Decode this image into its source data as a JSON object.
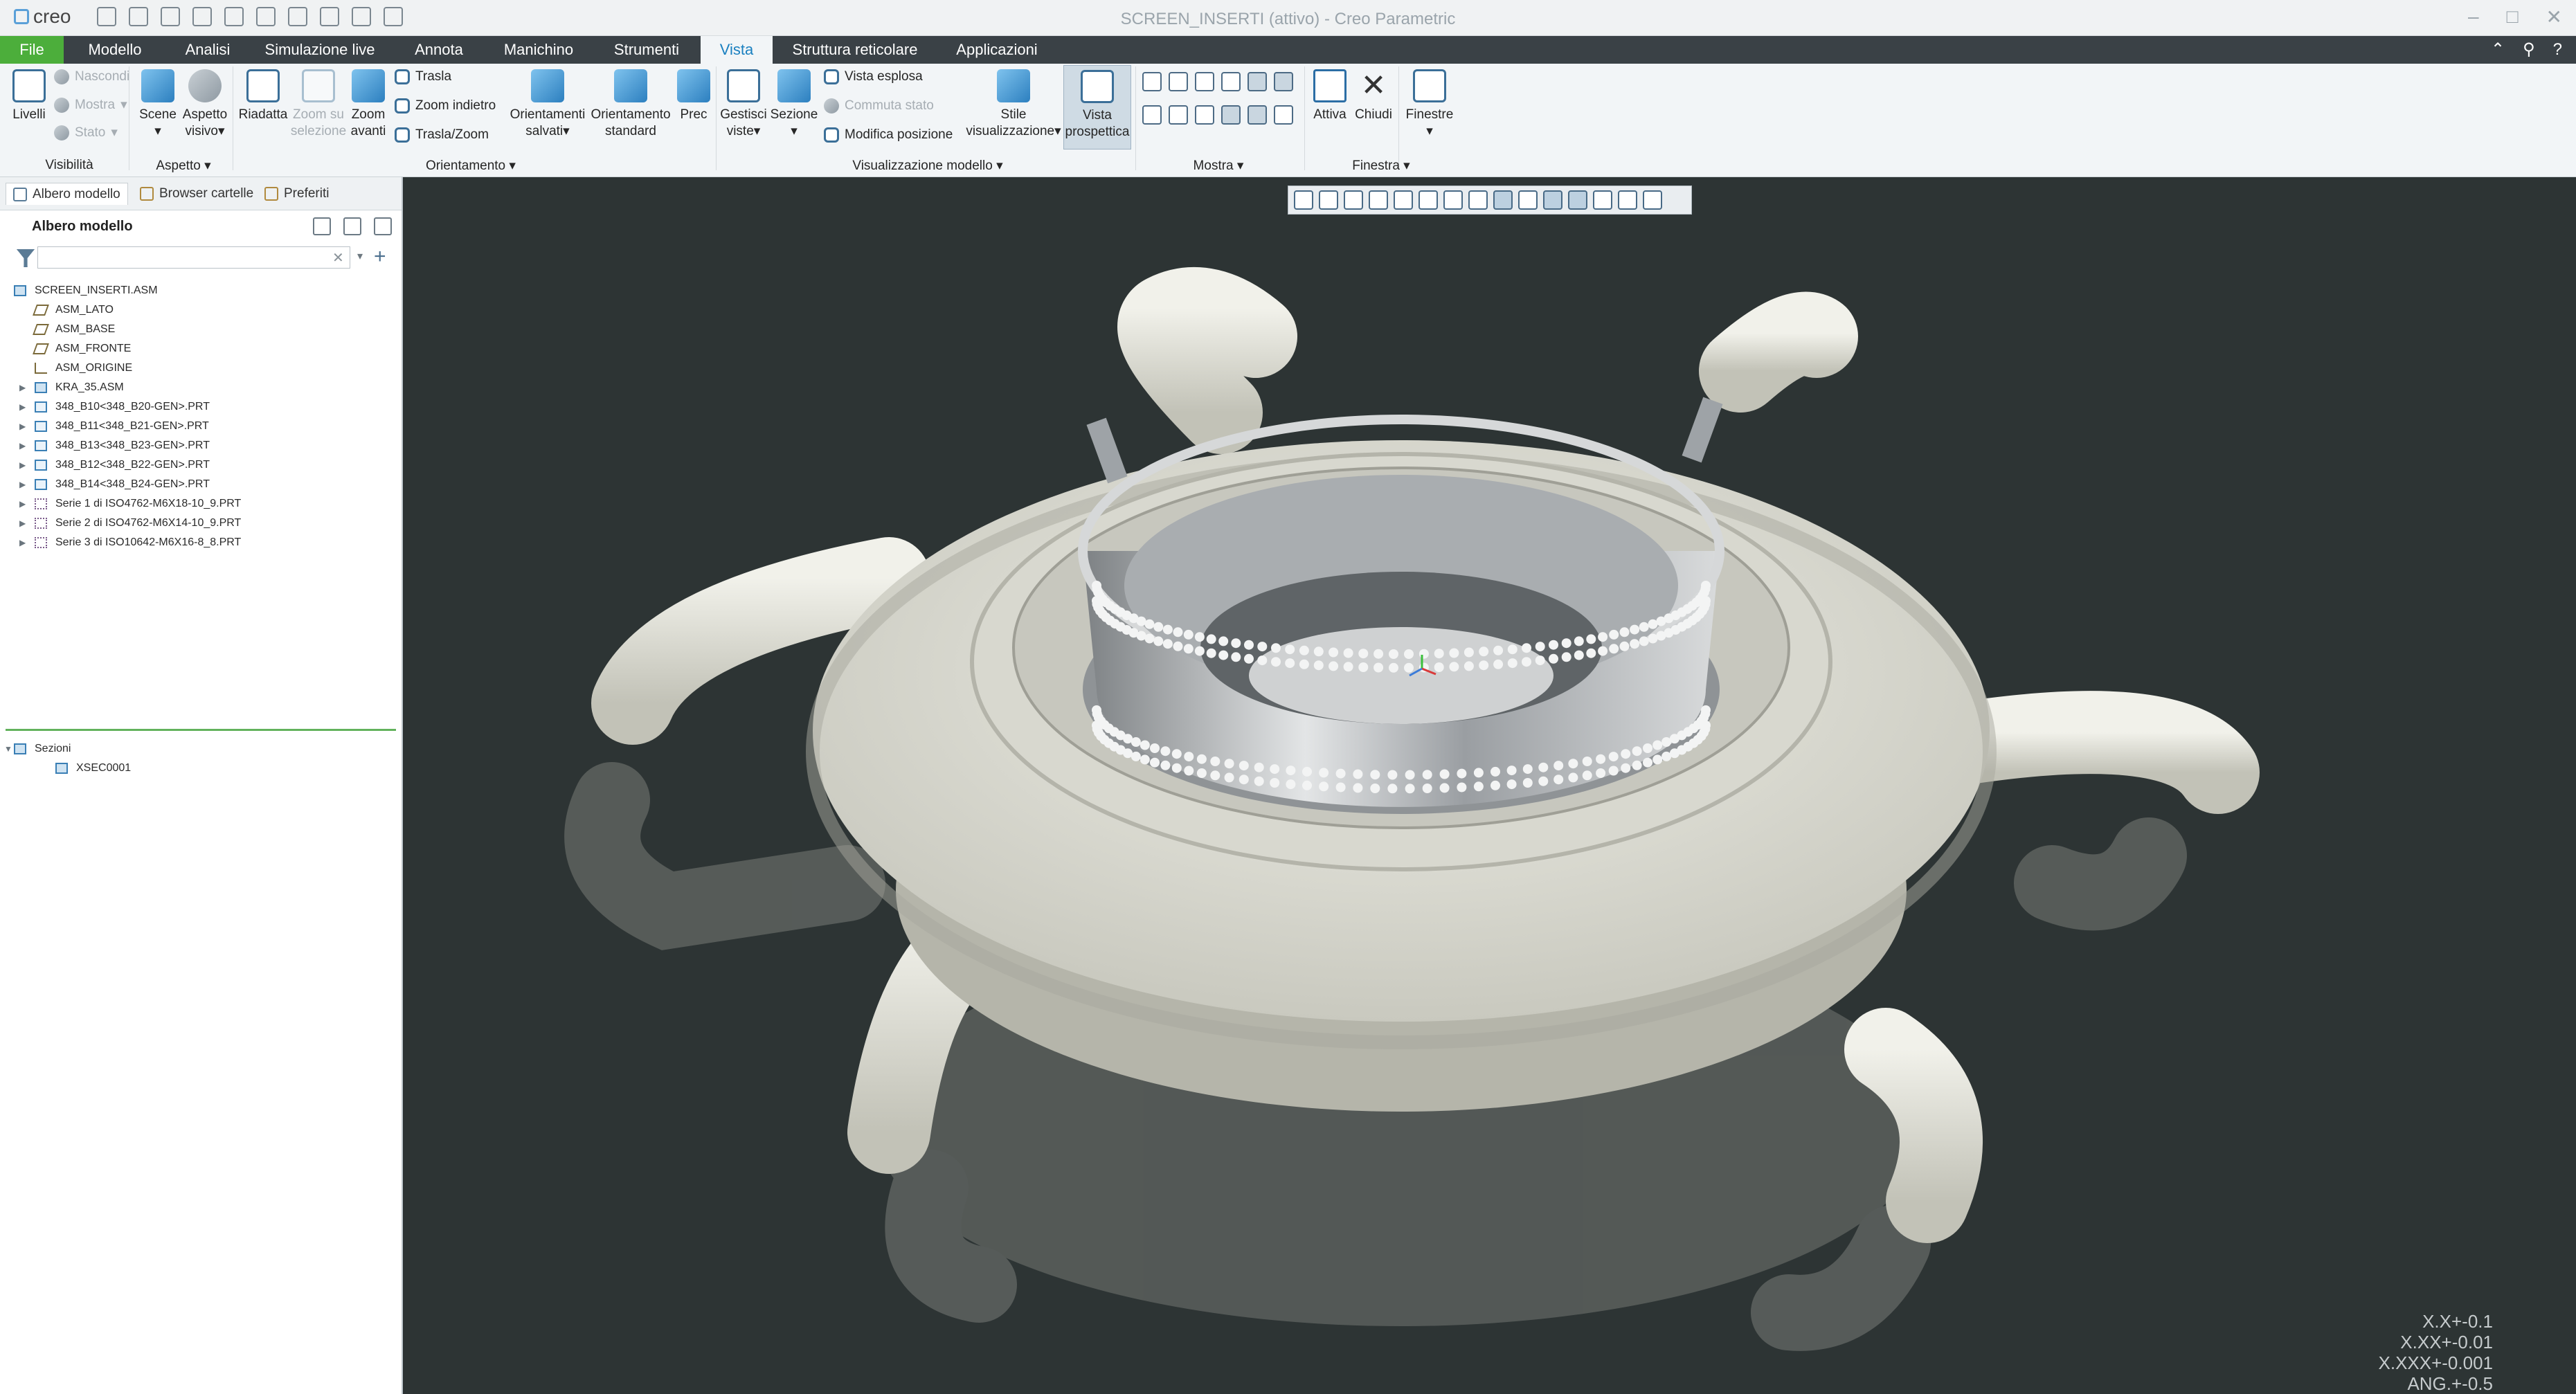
{
  "app": {
    "brand": "creo",
    "window_title": "SCREEN_INSERTI (attivo) - Creo Parametric"
  },
  "tabs": [
    "File",
    "Modello",
    "Analisi",
    "Simulazione live",
    "Annota",
    "Manichino",
    "Strumenti",
    "Vista",
    "Struttura reticolare",
    "Applicazioni"
  ],
  "active_tab": "Vista",
  "ribbon": {
    "visibilita": {
      "livelli": "Livelli",
      "nascondi": "Nascondi",
      "mostra": "Mostra",
      "stato": "Stato",
      "group": "Visibilità"
    },
    "aspetto": {
      "scene": "Scene",
      "aspetto_visivo_1": "Aspetto",
      "aspetto_visivo_2": "visivo",
      "group": "Aspetto"
    },
    "orientamento": {
      "riadatta": "Riadatta",
      "zoom_sel_1": "Zoom su",
      "zoom_sel_2": "selezione",
      "zoom_avanti_1": "Zoom",
      "zoom_avanti_2": "avanti",
      "trasla": "Trasla",
      "zoom_indietro": "Zoom indietro",
      "trasla_zoom": "Trasla/Zoom",
      "orient_salvati_1": "Orientamenti",
      "orient_salvati_2": "salvati",
      "orient_std_1": "Orientamento",
      "orient_std_2": "standard",
      "prec": "Prec",
      "group": "Orientamento"
    },
    "visualizzazione": {
      "gestisci_1": "Gestisci",
      "gestisci_2": "viste",
      "sezione": "Sezione",
      "vista_esplosa": "Vista esplosa",
      "commuta_stato": "Commuta stato",
      "modifica_posizione": "Modifica posizione",
      "stile_1": "Stile",
      "stile_2": "visualizzazione",
      "prospettica_1": "Vista",
      "prospettica_2": "prospettica",
      "group": "Visualizzazione modello"
    },
    "mostra_group": "Mostra",
    "finestra": {
      "attiva": "Attiva",
      "chiudi": "Chiudi",
      "finestre": "Finestre",
      "group": "Finestra"
    }
  },
  "panel": {
    "tabs": [
      "Albero modello",
      "Browser cartelle",
      "Preferiti"
    ],
    "header": "Albero modello",
    "filter_placeholder": "",
    "tree": [
      {
        "label": "SCREEN_INSERTI.ASM",
        "type": "asm",
        "level": 0,
        "expand": ""
      },
      {
        "label": "ASM_LATO",
        "type": "plane",
        "level": 1,
        "expand": ""
      },
      {
        "label": "ASM_BASE",
        "type": "plane",
        "level": 1,
        "expand": ""
      },
      {
        "label": "ASM_FRONTE",
        "type": "plane",
        "level": 1,
        "expand": ""
      },
      {
        "label": "ASM_ORIGINE",
        "type": "csys",
        "level": 1,
        "expand": ""
      },
      {
        "label": "KRA_35.ASM",
        "type": "asm",
        "level": 1,
        "expand": "▶"
      },
      {
        "label": "348_B10<348_B20-GEN>.PRT",
        "type": "part",
        "level": 1,
        "expand": "▶"
      },
      {
        "label": "348_B11<348_B21-GEN>.PRT",
        "type": "part",
        "level": 1,
        "expand": "▶"
      },
      {
        "label": "348_B13<348_B23-GEN>.PRT",
        "type": "part",
        "level": 1,
        "expand": "▶"
      },
      {
        "label": "348_B12<348_B22-GEN>.PRT",
        "type": "part",
        "level": 1,
        "expand": "▶"
      },
      {
        "label": "348_B14<348_B24-GEN>.PRT",
        "type": "part",
        "level": 1,
        "expand": "▶"
      },
      {
        "label": "Serie 1 di ISO4762-M6X18-10_9.PRT",
        "type": "pat",
        "level": 1,
        "expand": "▶"
      },
      {
        "label": "Serie 2 di ISO4762-M6X14-10_9.PRT",
        "type": "pat",
        "level": 1,
        "expand": "▶"
      },
      {
        "label": "Serie 3 di ISO10642-M6X16-8_8.PRT",
        "type": "pat",
        "level": 1,
        "expand": "▶"
      }
    ],
    "sections": [
      {
        "label": "Sezioni",
        "type": "asm",
        "level": 0,
        "expand": "▼"
      },
      {
        "label": "XSEC0001",
        "type": "asm",
        "level": 2,
        "expand": ""
      }
    ]
  },
  "viewport": {
    "tolerances": [
      "X.X+-0.1",
      "X.XX+-0.01",
      "X.XXX+-0.001",
      "ANG.+-0.5"
    ]
  }
}
